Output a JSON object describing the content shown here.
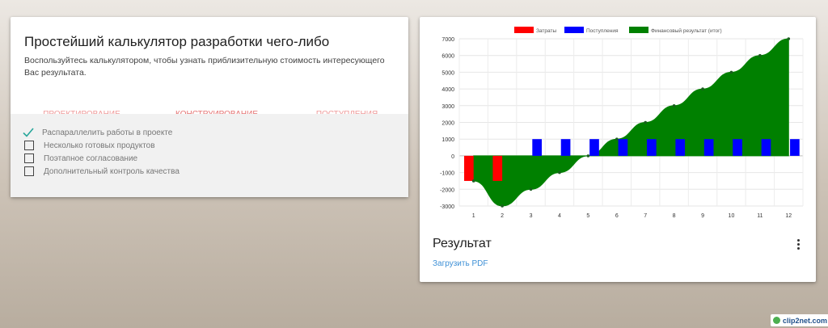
{
  "calculator": {
    "title": "Простейший калькулятор разработки чего-либо",
    "description": "Воспользуйтесь калькулятором, чтобы узнать приблизительную стоимость интересующего Вас результата.",
    "tabs": [
      {
        "label": "ПРОЕКТИРОВАНИЕ",
        "active": false
      },
      {
        "label": "КОНСТРУИРОВАНИЕ",
        "active": true
      },
      {
        "label": "ПОСТУПЛЕНИЯ",
        "active": false
      }
    ],
    "options": [
      {
        "label": "Распараллелить работы в проекте",
        "checked": true
      },
      {
        "label": "Несколько готовых продуктов",
        "checked": false
      },
      {
        "label": "Поэтапное согласование",
        "checked": false
      },
      {
        "label": "Дополнительный контроль качества",
        "checked": false
      }
    ]
  },
  "result": {
    "title": "Результат",
    "download_label": "Загрузить PDF"
  },
  "colors": {
    "costs": "#ff0000",
    "income": "#0000ff",
    "total": "#008000",
    "accent": "#e57373",
    "check": "#26a69a",
    "link": "#3e90d6"
  },
  "chart_data": {
    "type": "bar",
    "categories": [
      "1",
      "2",
      "3",
      "4",
      "5",
      "6",
      "7",
      "8",
      "9",
      "10",
      "11",
      "12"
    ],
    "series": [
      {
        "name": "Затраты",
        "type": "bar",
        "values": [
          -1500,
          -1500,
          0,
          0,
          0,
          0,
          0,
          0,
          0,
          0,
          0,
          0
        ]
      },
      {
        "name": "Поступления",
        "type": "bar",
        "values": [
          0,
          0,
          1000,
          1000,
          1000,
          1000,
          1000,
          1000,
          1000,
          1000,
          1000,
          1000
        ]
      },
      {
        "name": "Финансовый результат (итог)",
        "type": "area",
        "values": [
          -1500,
          -3000,
          -2000,
          -1000,
          0,
          1000,
          2000,
          3000,
          4000,
          5000,
          6000,
          7000
        ]
      }
    ],
    "ylim": [
      -3000,
      7000
    ],
    "yticks": [
      -3000,
      -2000,
      -1000,
      0,
      1000,
      2000,
      3000,
      4000,
      5000,
      6000,
      7000
    ],
    "grid": true,
    "legend": "top"
  },
  "watermark": "clip2net.com"
}
